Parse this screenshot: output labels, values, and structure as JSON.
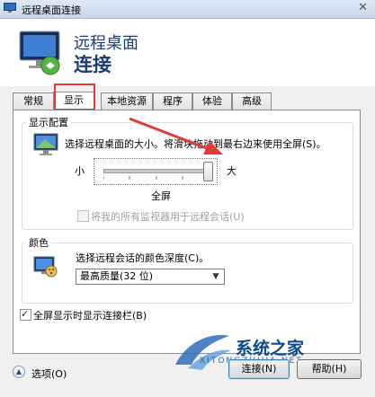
{
  "window": {
    "title": "远程桌面连接",
    "close_glyph": "✕"
  },
  "header": {
    "title_line1": "远程桌面",
    "title_line2": "连接"
  },
  "tabs": [
    {
      "label": "常规",
      "active": false
    },
    {
      "label": "显示",
      "active": true
    },
    {
      "label": "本地资源",
      "active": false
    },
    {
      "label": "程序",
      "active": false
    },
    {
      "label": "体验",
      "active": false
    },
    {
      "label": "高级",
      "active": false
    }
  ],
  "display_config": {
    "legend": "显示配置",
    "description": "选择远程桌面的大小。将滑块拖动到最右边来使用全屏(S)。",
    "slider": {
      "min_label": "小",
      "max_label": "大",
      "value_label": "全屏",
      "value_fraction": 1.0
    },
    "multimon_checkbox": {
      "label": "将我的所有监视器用于远程会话(U)",
      "checked": false,
      "disabled": true
    }
  },
  "colors_group": {
    "legend": "颜色",
    "description": "选择远程会话的颜色深度(C)。",
    "select_value": "最高质量(32 位)"
  },
  "connection_bar_checkbox": {
    "label": "全屏显示时显示连接栏(B)",
    "checked": true
  },
  "footer": {
    "options_label": "选项(O)",
    "connect_button": "连接(N)",
    "help_button": "帮助(H)"
  },
  "watermark": {
    "text": "系统之家",
    "subtext": "XITONGZHIJIA.NET"
  },
  "annotation_color": "#e53935"
}
